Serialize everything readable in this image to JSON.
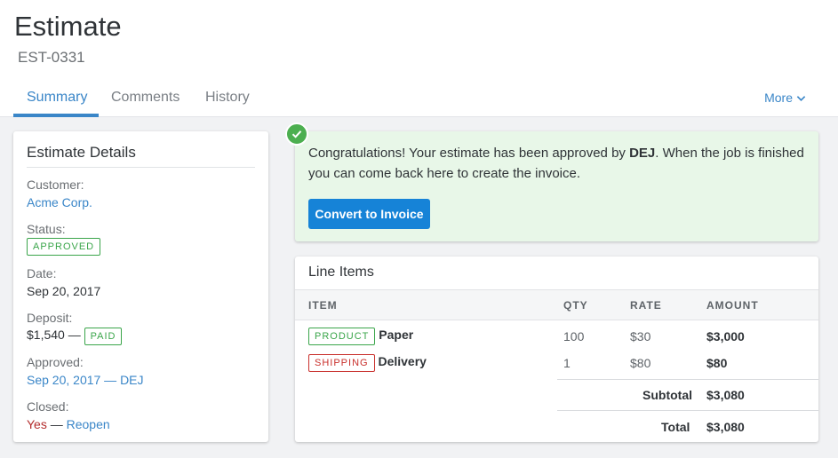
{
  "header": {
    "title": "Estimate",
    "subtitle": "EST-0331",
    "tabs": [
      {
        "label": "Summary",
        "active": true
      },
      {
        "label": "Comments",
        "active": false
      },
      {
        "label": "History",
        "active": false
      }
    ],
    "more_label": "More",
    "accent_color": "#3a86c8"
  },
  "details": {
    "title": "Estimate Details",
    "customer_label": "Customer:",
    "customer_value": "Acme Corp.",
    "status_label": "Status:",
    "status_value": "APPROVED",
    "date_label": "Date:",
    "date_value": "Sep 20, 2017",
    "deposit_label": "Deposit:",
    "deposit_value": "$1,540 —",
    "deposit_badge": "PAID",
    "approved_label": "Approved:",
    "approved_value": "Sep 20, 2017 — DEJ",
    "closed_label": "Closed:",
    "closed_value": "Yes",
    "closed_sep": "—",
    "reopen_label": "Reopen"
  },
  "alert": {
    "text_before": "Congratulations! Your estimate has been approved by ",
    "approver": "DEJ",
    "text_after": ". When the job is finished you can come back here to create the invoice.",
    "button_label": "Convert to Invoice",
    "icon": "check-icon"
  },
  "line_items": {
    "title": "Line Items",
    "columns": [
      "ITEM",
      "QTY",
      "RATE",
      "AMOUNT"
    ],
    "rows": [
      {
        "tag": "PRODUCT",
        "name": "Paper",
        "qty": "100",
        "rate": "$30",
        "amount": "$3,000"
      },
      {
        "tag": "SHIPPING",
        "name": "Delivery",
        "qty": "1",
        "rate": "$80",
        "amount": "$80"
      }
    ],
    "subtotal_label": "Subtotal",
    "subtotal_value": "$3,080",
    "total_label": "Total",
    "total_value": "$3,080"
  }
}
